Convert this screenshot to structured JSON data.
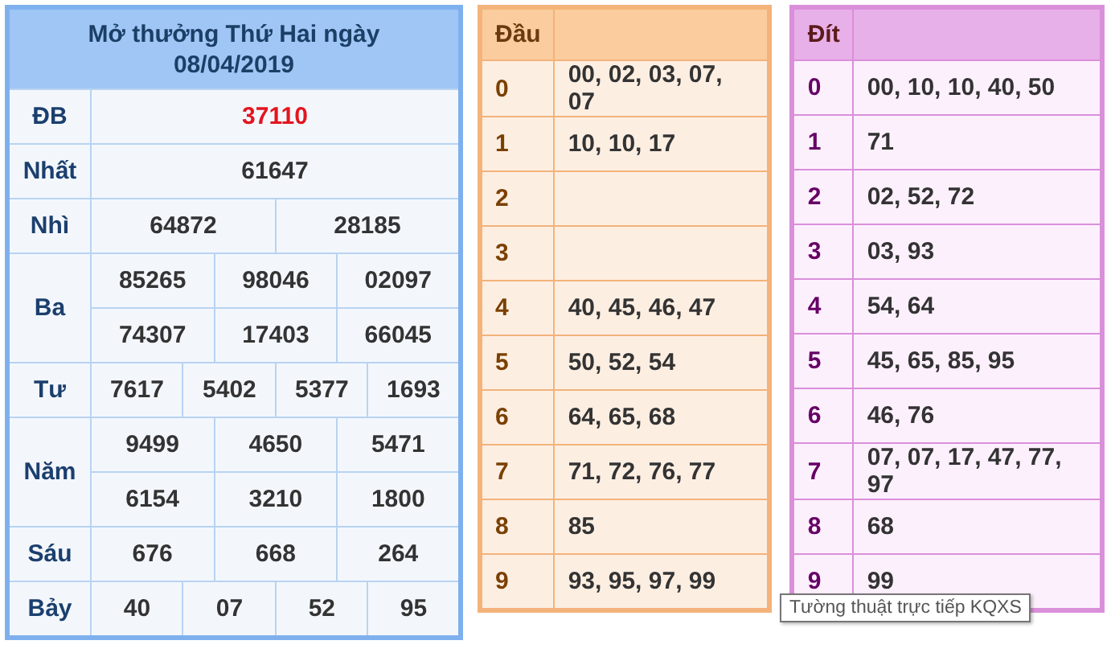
{
  "results": {
    "title": "Mở thưởng Thứ Hai ngày 08/04/2019",
    "prizes": [
      {
        "label": "ĐB",
        "special": true,
        "rows": [
          [
            "37110"
          ]
        ]
      },
      {
        "label": "Nhất",
        "special": false,
        "rows": [
          [
            "61647"
          ]
        ]
      },
      {
        "label": "Nhì",
        "special": false,
        "rows": [
          [
            "64872",
            "28185"
          ]
        ]
      },
      {
        "label": "Ba",
        "special": false,
        "rows": [
          [
            "85265",
            "98046",
            "02097"
          ],
          [
            "74307",
            "17403",
            "66045"
          ]
        ]
      },
      {
        "label": "Tư",
        "special": false,
        "rows": [
          [
            "7617",
            "5402",
            "5377",
            "1693"
          ]
        ]
      },
      {
        "label": "Năm",
        "special": false,
        "rows": [
          [
            "9499",
            "4650",
            "5471"
          ],
          [
            "6154",
            "3210",
            "1800"
          ]
        ]
      },
      {
        "label": "Sáu",
        "special": false,
        "rows": [
          [
            "676",
            "668",
            "264"
          ]
        ]
      },
      {
        "label": "Bảy",
        "special": false,
        "rows": [
          [
            "40",
            "07",
            "52",
            "95"
          ]
        ]
      }
    ]
  },
  "heads": {
    "header": "Đầu",
    "rows": [
      {
        "key": "0",
        "values": "00, 02, 03, 07, 07"
      },
      {
        "key": "1",
        "values": "10, 10, 17"
      },
      {
        "key": "2",
        "values": ""
      },
      {
        "key": "3",
        "values": ""
      },
      {
        "key": "4",
        "values": "40, 45, 46, 47"
      },
      {
        "key": "5",
        "values": "50, 52, 54"
      },
      {
        "key": "6",
        "values": "64, 65, 68"
      },
      {
        "key": "7",
        "values": "71, 72, 76, 77"
      },
      {
        "key": "8",
        "values": "85"
      },
      {
        "key": "9",
        "values": "93, 95, 97, 99"
      }
    ]
  },
  "tails": {
    "header": "Đít",
    "rows": [
      {
        "key": "0",
        "values": "00, 10, 10, 40, 50"
      },
      {
        "key": "1",
        "values": "71"
      },
      {
        "key": "2",
        "values": "02, 52, 72"
      },
      {
        "key": "3",
        "values": "03, 93"
      },
      {
        "key": "4",
        "values": "54, 64"
      },
      {
        "key": "5",
        "values": "45, 65, 85, 95"
      },
      {
        "key": "6",
        "values": "46, 76"
      },
      {
        "key": "7",
        "values": "07, 07, 17, 47, 77, 97"
      },
      {
        "key": "8",
        "values": "68"
      },
      {
        "key": "9",
        "values": "99"
      }
    ]
  },
  "tooltip": "Tường thuật trực tiếp KQXS"
}
